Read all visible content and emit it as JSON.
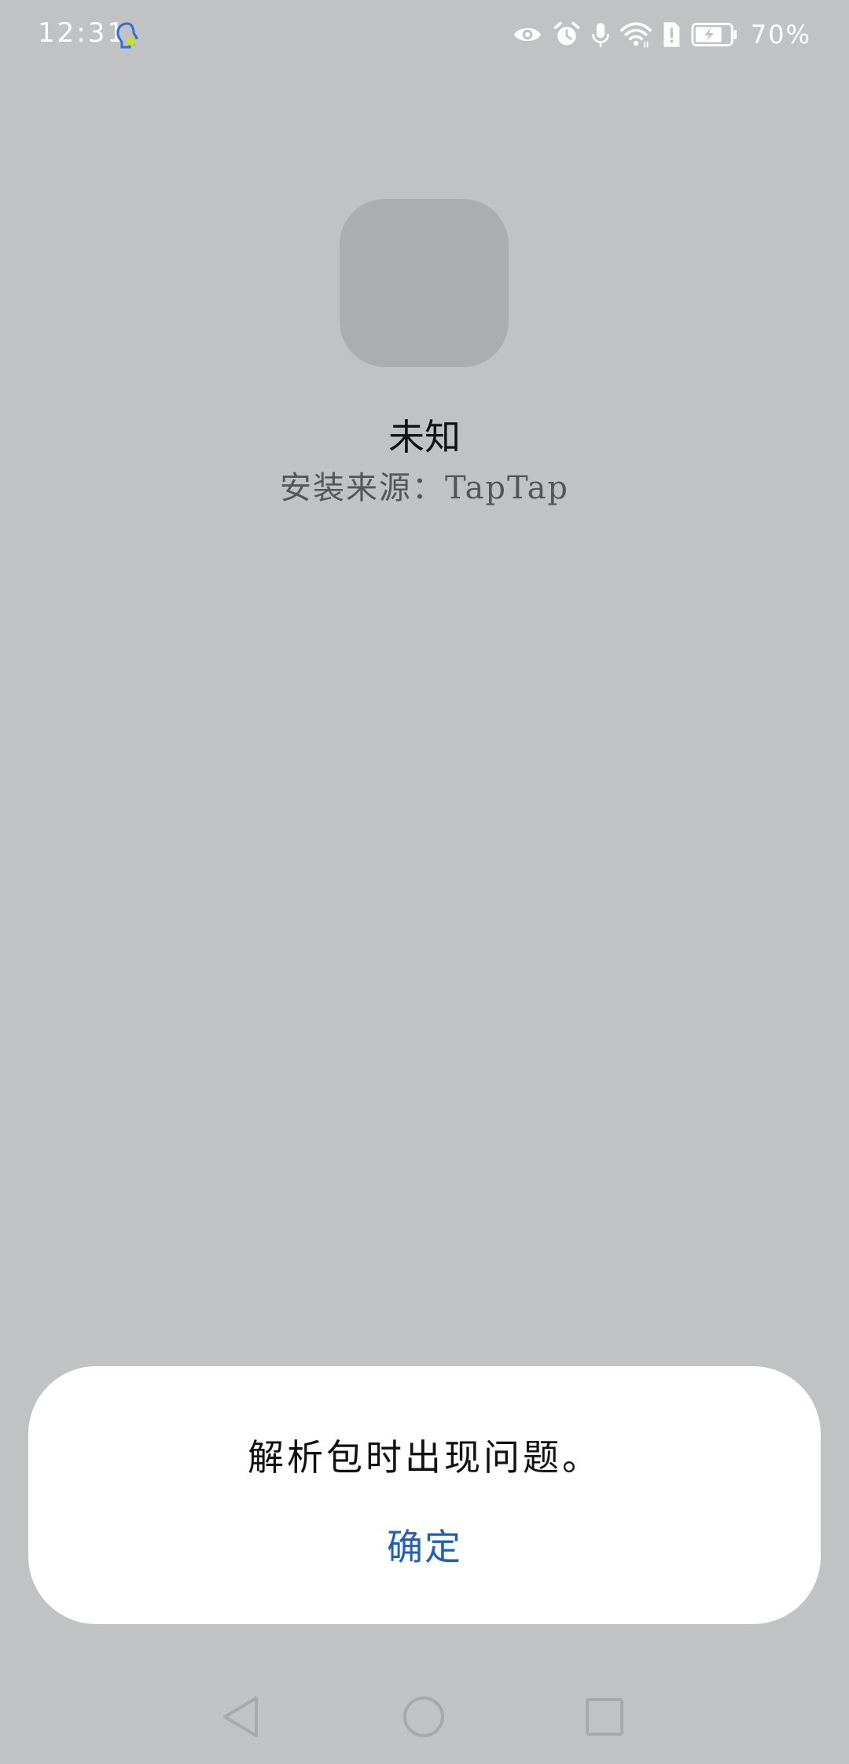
{
  "status_bar": {
    "time": "12:31",
    "battery_percent": "70%",
    "icons": [
      "assistant-icon",
      "eye-icon",
      "alarm-icon",
      "microphone-icon",
      "wifi-icon",
      "sim-alert-icon",
      "battery-charging-icon"
    ]
  },
  "app": {
    "name": "未知",
    "install_source": "安装来源：TapTap"
  },
  "dialog": {
    "message": "解析包时出现问题。",
    "confirm_label": "确定",
    "confirm_color": "#1f5fbf"
  },
  "nav_bar": {
    "buttons": [
      "back-icon",
      "home-icon",
      "recents-icon"
    ]
  }
}
